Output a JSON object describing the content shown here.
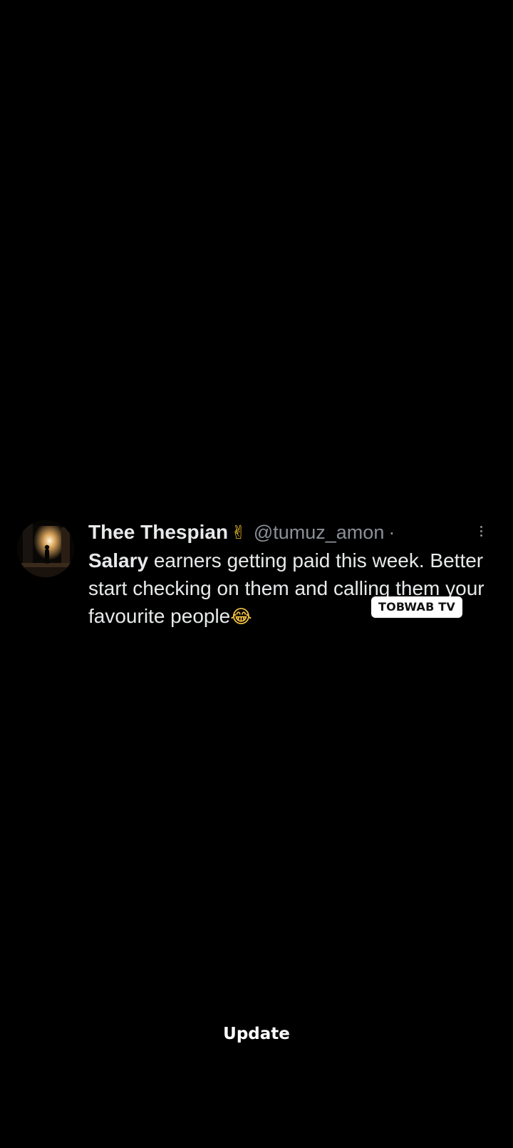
{
  "tweet": {
    "display_name": "Thee Thespian",
    "name_emoji": "✌",
    "handle": "@tumuz_amon",
    "separator": "·",
    "text_bold": "Salary",
    "text_rest": " earners getting paid this week. Better start checking on them and calling them your favourite people",
    "text_emoji": "😂",
    "more_icon": "more-vertical-icon",
    "avatar_icon": "profile-photo-silhouette"
  },
  "watermark": {
    "label": "TOBWAB TV"
  },
  "caption": {
    "label": "Update"
  },
  "colors": {
    "background": "#000000",
    "primary_text": "#e7e9ea",
    "secondary_text": "#8b9096",
    "watermark_bg": "#ffffff"
  }
}
